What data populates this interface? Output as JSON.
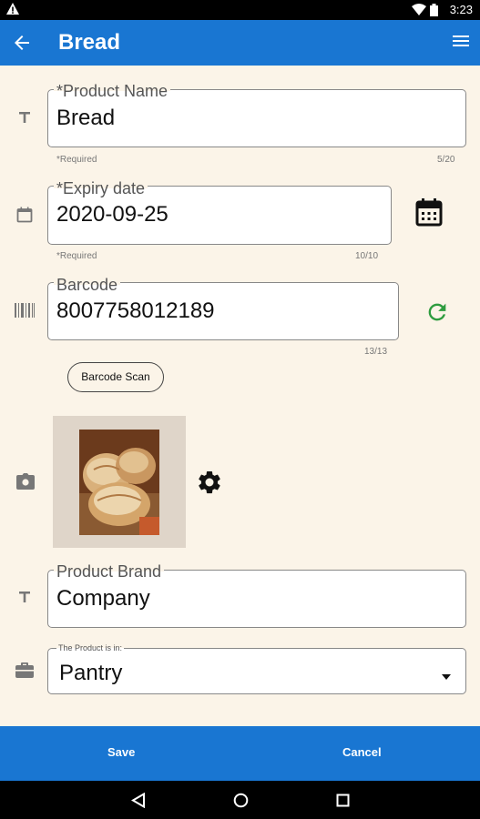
{
  "status": {
    "time": "3:23"
  },
  "appbar": {
    "title": "Bread"
  },
  "form": {
    "product_name": {
      "label": "*Product Name",
      "value": "Bread",
      "helper": "*Required",
      "counter": "5/20"
    },
    "expiry_date": {
      "label": "*Expiry date",
      "value": "2020-09-25",
      "helper": "*Required",
      "counter": "10/10"
    },
    "barcode": {
      "label": "Barcode",
      "value": "8007758012189",
      "counter": "13/13"
    },
    "barcode_scan_label": "Barcode Scan",
    "product_brand": {
      "label": "Product Brand",
      "value": "Company"
    },
    "location": {
      "label": "The Product is in:",
      "value": "Pantry"
    }
  },
  "actions": {
    "save": "Save",
    "cancel": "Cancel"
  },
  "colors": {
    "primary": "#1976d2",
    "background": "#fbf4e8",
    "refresh": "#2e9c3f"
  },
  "icons": [
    "warning-icon",
    "wifi-icon",
    "battery-icon",
    "back-arrow-icon",
    "menu-icon",
    "text-icon",
    "calendar-icon",
    "calendar-picker-icon",
    "barcode-icon",
    "refresh-icon",
    "camera-icon",
    "settings-icon",
    "briefcase-icon",
    "dropdown-icon",
    "nav-back-icon",
    "nav-home-icon",
    "nav-recents-icon"
  ]
}
